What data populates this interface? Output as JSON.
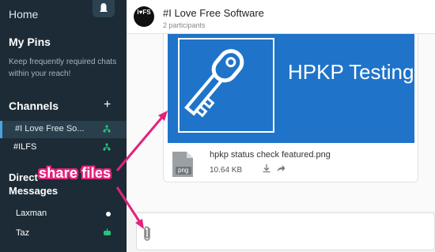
{
  "sidebar": {
    "home": "Home",
    "pins_title": "My Pins",
    "pins_desc": "Keep frequently required chats within your reach!",
    "channels_title": "Channels",
    "add_icon": "plus-icon",
    "channels": [
      {
        "label": "#I Love Free So...",
        "icon": "group-icon",
        "active": true
      },
      {
        "label": "#ILFS",
        "icon": "group-icon",
        "active": false
      }
    ],
    "direct_title": "Direct Messages",
    "direct": [
      {
        "label": "Laxman",
        "status": "online-dot"
      },
      {
        "label": "Taz",
        "status": "bot-icon"
      }
    ]
  },
  "header": {
    "avatar_text": "I♥FS",
    "title": "#I Love Free Software",
    "subtitle": "2 participants"
  },
  "attachment": {
    "thumb_text": "HPKP Testing",
    "file_name": "hpkp status check featured.png",
    "file_ext": "png",
    "file_size": "10.64 KB"
  },
  "annotation": {
    "label": "share files",
    "color": "#e2237b"
  }
}
